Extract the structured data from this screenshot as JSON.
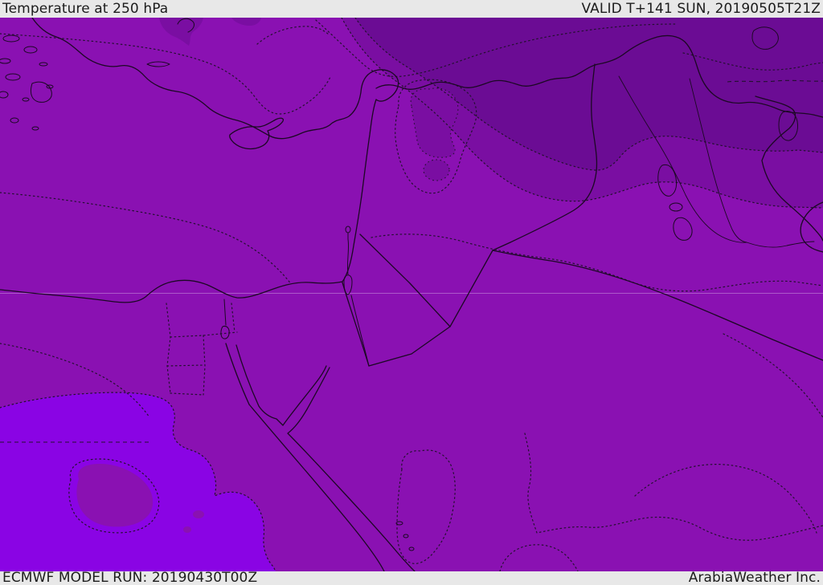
{
  "header": {
    "title": "Temperature at 250 hPa",
    "valid_label": "VALID T+141 SUN, 20190505T21Z"
  },
  "footer": {
    "model_run": "ECMWF MODEL RUN: 20190430T00Z",
    "attribution": "ArabiaWeather Inc."
  },
  "map": {
    "description": "Shaded 250 hPa temperature forecast map over the Middle East with dotted temperature contours and solid coastlines and borders",
    "colors": {
      "temp_main": "#8A11B2",
      "temp_cooler": "#7A0EA2",
      "temp_coolest": "#6B0C94",
      "temp_warmer": "#8A04E4",
      "coastline": "#1C0824",
      "contour": "#241030",
      "latitude_line": "rgba(232,206,242,0.38)",
      "bar_background": "#E8E8E8",
      "bar_text": "#1C1C1C"
    },
    "shade_levels": [
      {
        "name": "coolest",
        "color": "#6B0C94"
      },
      {
        "name": "cooler",
        "color": "#7A0EA2"
      },
      {
        "name": "base",
        "color": "#8A11B2"
      },
      {
        "name": "warmer",
        "color": "#8A04E4"
      }
    ]
  }
}
